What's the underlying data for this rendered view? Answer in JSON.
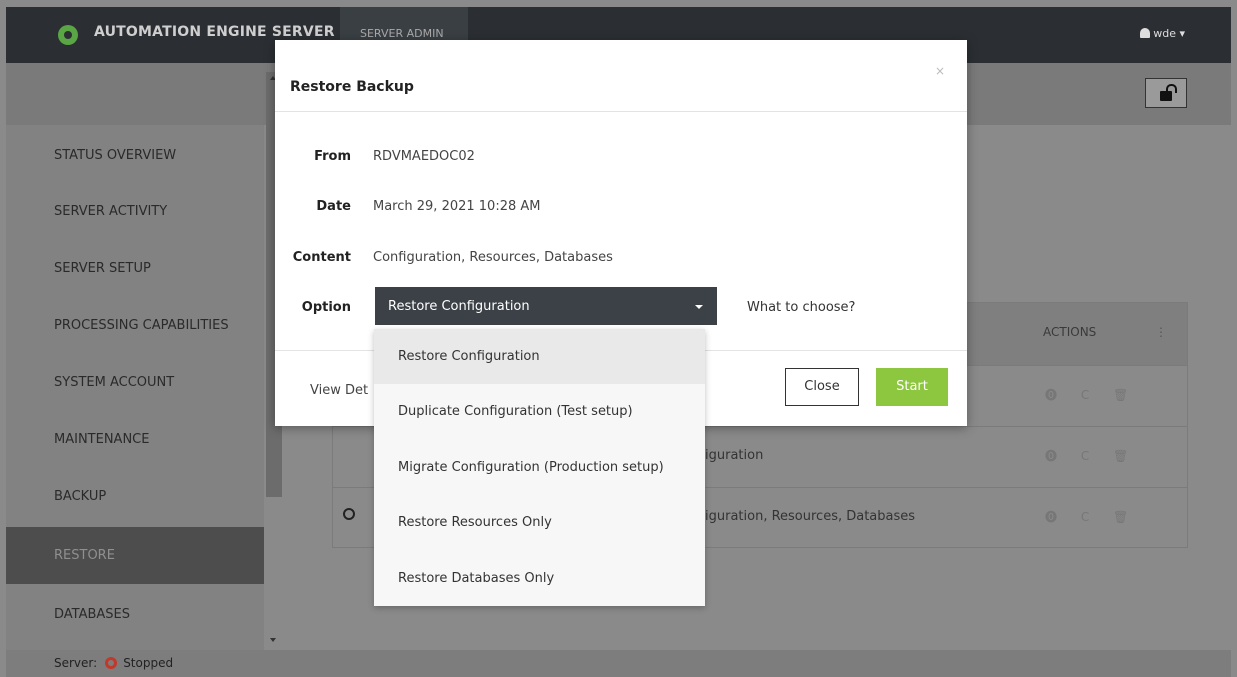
{
  "topbar": {
    "app_title": "AUTOMATION ENGINE SERVER",
    "admin_tab": "SERVER ADMIN",
    "user": "wde"
  },
  "sidebar": {
    "items": [
      {
        "label": "STATUS OVERVIEW"
      },
      {
        "label": "SERVER ACTIVITY"
      },
      {
        "label": "SERVER SETUP"
      },
      {
        "label": "PROCESSING CAPABILITIES"
      },
      {
        "label": "SYSTEM ACCOUNT"
      },
      {
        "label": "MAINTENANCE"
      },
      {
        "label": "BACKUP"
      },
      {
        "label": "RESTORE"
      },
      {
        "label": "DATABASES"
      }
    ],
    "active": "RESTORE"
  },
  "table": {
    "actions_header": "ACTIONS",
    "kebab": "⋮",
    "rows": [
      {
        "text": ""
      },
      {
        "text": "iguration"
      },
      {
        "text": "iguration, Resources, Databases"
      }
    ],
    "action_icons": "⓿ C 🗑"
  },
  "status": {
    "label": "Server:",
    "state": "Stopped"
  },
  "modal": {
    "title": "Restore Backup",
    "close_x": "×",
    "from_label": "From",
    "from_value": "RDVMAEDOC02",
    "date_label": "Date",
    "date_value": "March 29, 2021 10:28 AM",
    "content_label": "Content",
    "content_value": "Configuration, Resources, Databases",
    "option_label": "Option",
    "option_selected": "Restore Configuration",
    "help_link": "What to choose?",
    "view_details": "View Det",
    "close_button": "Close",
    "start_button": "Start"
  },
  "dropdown": {
    "options": [
      "Restore Configuration",
      "Duplicate Configuration (Test setup)",
      "Migrate Configuration (Production setup)",
      "Restore Resources Only",
      "Restore Databases Only"
    ]
  },
  "colors": {
    "topbar": "#2b2f33",
    "accent_green": "#8dc63f",
    "select_bg": "#3b4147",
    "stopped": "#c0392b"
  }
}
